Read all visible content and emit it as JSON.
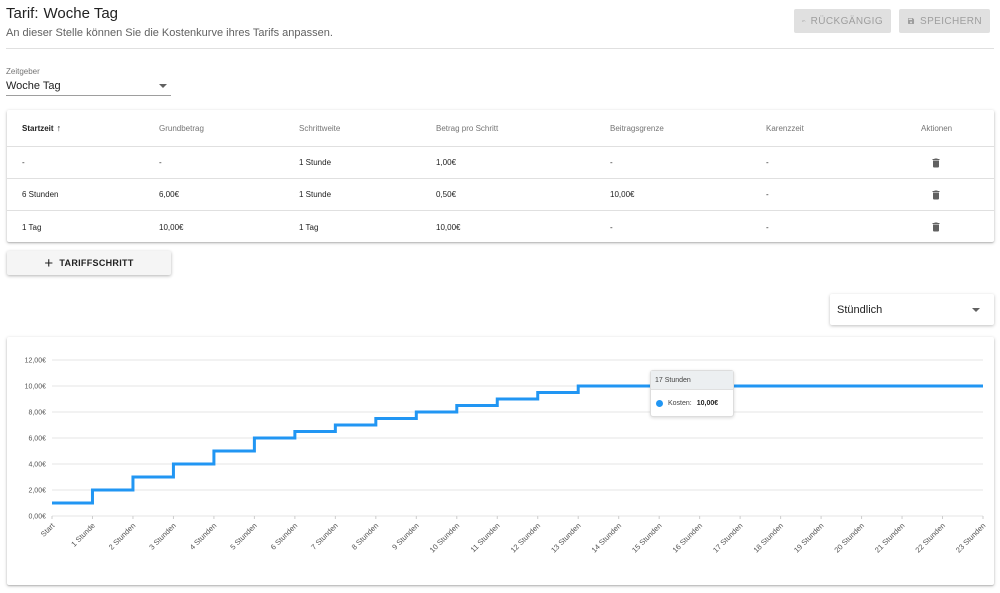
{
  "header": {
    "prefix": "Tarif:",
    "name": "Woche Tag",
    "subtitle": "An dieser Stelle können Sie die Kostenkurve ihres Tarifs anpassen.",
    "undo_label": "RÜCKGÄNGIG",
    "save_label": "SPEICHERN"
  },
  "timer_select": {
    "label": "Zeitgeber",
    "value": "Woche Tag"
  },
  "table": {
    "columns": [
      "Startzeit",
      "Grundbetrag",
      "Schrittweite",
      "Betrag pro Schritt",
      "Beitragsgrenze",
      "Karenzzeit",
      "Aktionen"
    ],
    "rows": [
      [
        "-",
        "-",
        "1 Stunde",
        "1,00€",
        "-",
        "-"
      ],
      [
        "6 Stunden",
        "6,00€",
        "1 Stunde",
        "0,50€",
        "10,00€",
        "-"
      ],
      [
        "1 Tag",
        "10,00€",
        "1 Tag",
        "10,00€",
        "-",
        "-"
      ]
    ]
  },
  "add_button_label": "TARIFFSCHRITT",
  "interval_select": {
    "value": "Stündlich"
  },
  "tooltip": {
    "title": "17 Stunden",
    "label": "Kosten:",
    "value": "10,00€"
  },
  "colors": {
    "line": "#2196f3",
    "accent": "#2196f3"
  },
  "chart_data": {
    "type": "line",
    "step": true,
    "categories": [
      "Start",
      "1 Stunde",
      "2 Stunden",
      "3 Stunden",
      "4 Stunden",
      "5 Stunden",
      "6 Stunden",
      "7 Stunden",
      "8 Stunden",
      "9 Stunden",
      "10 Stunden",
      "11 Stunden",
      "12 Stunden",
      "13 Stunden",
      "14 Stunden",
      "15 Stunden",
      "16 Stunden",
      "17 Stunden",
      "18 Stunden",
      "19 Stunden",
      "20 Stunden",
      "21 Stunden",
      "22 Stunden",
      "23 Stunden"
    ],
    "series": [
      {
        "name": "Kosten",
        "values": [
          1,
          2,
          3,
          4,
          5,
          6,
          6.5,
          7,
          7.5,
          8,
          8.5,
          9,
          9.5,
          10,
          10,
          10,
          10,
          10,
          10,
          10,
          10,
          10,
          10,
          10
        ]
      }
    ],
    "yticks": [
      "0,00€",
      "2,00€",
      "4,00€",
      "6,00€",
      "8,00€",
      "10,00€",
      "12,00€"
    ],
    "ylim": [
      0,
      12
    ],
    "grid": true
  }
}
